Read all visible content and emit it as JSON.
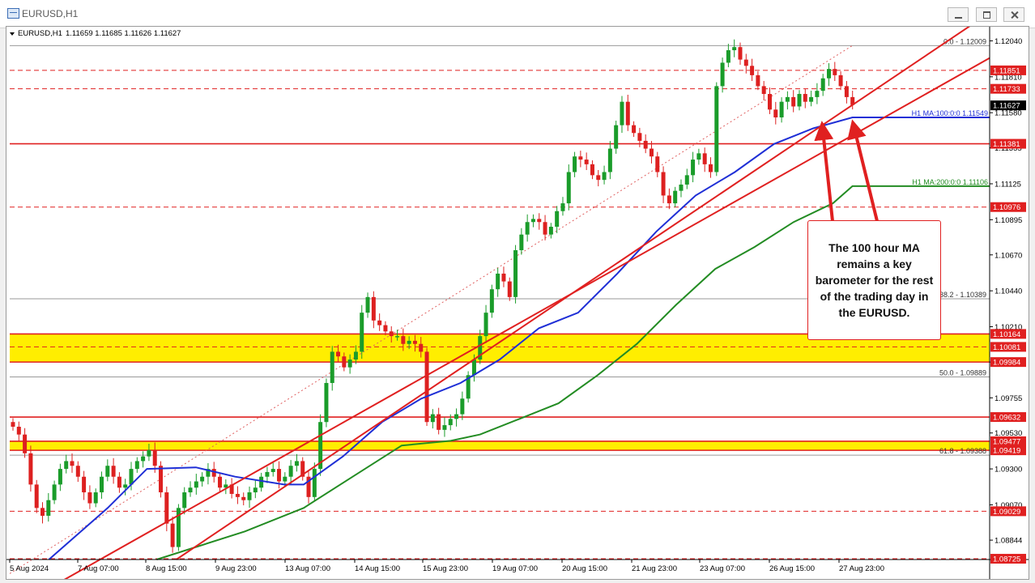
{
  "window": {
    "title": "EURUSD,H1"
  },
  "header": {
    "symbol": "EURUSD,H1",
    "ohlc": "1.11659 1.11685 1.11626 1.11627"
  },
  "annotation": {
    "text": "The 100 hour MA remains a key barometer for the rest of the trading day in the EURUSD."
  },
  "colors": {
    "up_candle": "#1a9c2a",
    "down_candle": "#dd2020",
    "ma100": "#1f2fd6",
    "ma200": "#238c23",
    "level_line": "#e02020",
    "zone": "#ffee00",
    "label_bg": "#e02020",
    "fib": "#707070"
  },
  "chart_data": {
    "type": "candlestick",
    "title": "EURUSD,H1",
    "ylim": [
      1.0872,
      1.1212
    ],
    "y_ticks": [
      "1.12040",
      "1.11810",
      "1.11580",
      "1.11355",
      "1.11125",
      "1.10895",
      "1.10670",
      "1.10440",
      "1.10210",
      "1.09984",
      "1.09755",
      "1.09530",
      "1.09300",
      "1.09070",
      "1.08844"
    ],
    "x_ticks": [
      "5 Aug 2024",
      "7 Aug 07:00",
      "8 Aug 15:00",
      "9 Aug 23:00",
      "13 Aug 07:00",
      "14 Aug 15:00",
      "15 Aug 23:00",
      "19 Aug 07:00",
      "20 Aug 15:00",
      "21 Aug 23:00",
      "23 Aug 07:00",
      "26 Aug 15:00",
      "27 Aug 23:00"
    ],
    "price_path": [
      1.096,
      1.0957,
      1.0952,
      1.094,
      1.092,
      1.0905,
      1.09,
      1.091,
      1.092,
      1.093,
      1.0935,
      1.0932,
      1.0925,
      1.0915,
      1.0908,
      1.0915,
      1.0925,
      1.0932,
      1.0925,
      1.0918,
      1.092,
      1.093,
      1.0935,
      1.0938,
      1.0942,
      1.0932,
      1.0915,
      1.0895,
      1.088,
      1.0905,
      1.0915,
      1.0918,
      1.0922,
      1.0925,
      1.093,
      1.0925,
      1.0918,
      1.092,
      1.0914,
      1.0912,
      1.091,
      1.0915,
      1.0918,
      1.0925,
      1.0928,
      1.093,
      1.0922,
      1.0925,
      1.0932,
      1.0935,
      1.0925,
      1.0912,
      1.093,
      1.096,
      1.0985,
      1.1005,
      1.1002,
      1.0995,
      1.1,
      1.1005,
      1.103,
      1.104,
      1.1025,
      1.1022,
      1.1018,
      1.1015,
      1.1015,
      1.101,
      1.1012,
      1.101,
      1.1005,
      1.096,
      1.0965,
      1.0955,
      1.0958,
      1.0962,
      1.0965,
      1.0975,
      1.099,
      1.1,
      1.1015,
      1.103,
      1.1045,
      1.1055,
      1.105,
      1.104,
      1.107,
      1.108,
      1.1088,
      1.109,
      1.1088,
      1.108,
      1.1085,
      1.1095,
      1.11,
      1.112,
      1.113,
      1.1128,
      1.1125,
      1.1118,
      1.1115,
      1.112,
      1.1135,
      1.115,
      1.1165,
      1.115,
      1.1145,
      1.114,
      1.1135,
      1.113,
      1.112,
      1.1105,
      1.11,
      1.1108,
      1.1112,
      1.1118,
      1.1128,
      1.1132,
      1.1125,
      1.112,
      1.1175,
      1.119,
      1.1198,
      1.12,
      1.1192,
      1.1188,
      1.1182,
      1.1175,
      1.117,
      1.116,
      1.1155,
      1.1165,
      1.1168,
      1.1162,
      1.117,
      1.1165,
      1.1168,
      1.1172,
      1.118,
      1.1186,
      1.1182,
      1.1175,
      1.1168,
      1.1163
    ],
    "moving_averages": [
      {
        "name": "H1 MA:100:0:0",
        "value": "1.11549",
        "path": [
          [
            0.04,
            1.0872
          ],
          [
            0.1,
            1.0905
          ],
          [
            0.14,
            1.093
          ],
          [
            0.19,
            1.0931
          ],
          [
            0.23,
            1.0925
          ],
          [
            0.28,
            1.092
          ],
          [
            0.3,
            1.092
          ],
          [
            0.34,
            1.0938
          ],
          [
            0.38,
            1.096
          ],
          [
            0.42,
            1.0975
          ],
          [
            0.46,
            1.0985
          ],
          [
            0.5,
            1.1
          ],
          [
            0.54,
            1.102
          ],
          [
            0.58,
            1.103
          ],
          [
            0.62,
            1.1055
          ],
          [
            0.66,
            1.1082
          ],
          [
            0.7,
            1.1105
          ],
          [
            0.74,
            1.112
          ],
          [
            0.78,
            1.1138
          ],
          [
            0.82,
            1.1148
          ],
          [
            0.86,
            1.1155
          ],
          [
            1.0,
            1.1155
          ]
        ]
      },
      {
        "name": "H1 MA:200:0:0",
        "value": "1.11106",
        "path": [
          [
            0.15,
            1.0872
          ],
          [
            0.24,
            1.089
          ],
          [
            0.3,
            1.0905
          ],
          [
            0.35,
            1.0925
          ],
          [
            0.4,
            1.0945
          ],
          [
            0.45,
            1.0948
          ],
          [
            0.48,
            1.0952
          ],
          [
            0.52,
            1.0962
          ],
          [
            0.56,
            1.0972
          ],
          [
            0.6,
            1.099
          ],
          [
            0.64,
            1.101
          ],
          [
            0.68,
            1.1035
          ],
          [
            0.72,
            1.1058
          ],
          [
            0.76,
            1.1072
          ],
          [
            0.8,
            1.1088
          ],
          [
            0.84,
            1.11
          ],
          [
            0.86,
            1.1111
          ],
          [
            1.0,
            1.1111
          ]
        ]
      }
    ],
    "trend_lines": [
      [
        [
          0.17,
          1.0872
        ],
        [
          1.0,
          1.1222
        ]
      ],
      [
        [
          0.03,
          1.085
        ],
        [
          1.0,
          1.1193
        ]
      ]
    ],
    "fib_diagonal": [
      [
        0.0,
        1.0863
      ],
      [
        0.86,
        1.1201
      ]
    ],
    "horizontal_levels": [
      {
        "label": "1.11851",
        "price": 1.11851,
        "style": "dashed"
      },
      {
        "label": "1.11733",
        "price": 1.11733,
        "style": "dashed"
      },
      {
        "label": "1.11381",
        "price": 1.11381,
        "style": "solid"
      },
      {
        "label": "1.10976",
        "price": 1.10976,
        "style": "dashed"
      },
      {
        "label": "1.10164",
        "price": 1.10164,
        "style": "solid"
      },
      {
        "label": "1.10081",
        "price": 1.10081,
        "style": "dashed"
      },
      {
        "label": "1.09984",
        "price": 1.09984,
        "style": "solid"
      },
      {
        "label": "1.09632",
        "price": 1.09632,
        "style": "solid"
      },
      {
        "label": "1.09477",
        "price": 1.09477,
        "style": "solid"
      },
      {
        "label": "1.09419",
        "price": 1.09419,
        "style": "solid"
      },
      {
        "label": "1.09029",
        "price": 1.09029,
        "style": "dashed"
      },
      {
        "label": "1.08725",
        "price": 1.08725,
        "style": "dashed"
      }
    ],
    "zones": [
      [
        1.09984,
        1.10164
      ],
      [
        1.09419,
        1.09477
      ]
    ],
    "fib_levels": [
      {
        "label": "0.0 - 1.12009",
        "price": 1.12009
      },
      {
        "label": "38.2 - 1.10389",
        "price": 1.10389
      },
      {
        "label": "50.0 - 1.09889",
        "price": 1.09889
      },
      {
        "label": "61.8 - 1.09388",
        "price": 1.09388
      }
    ],
    "current_price": "1.11627"
  }
}
